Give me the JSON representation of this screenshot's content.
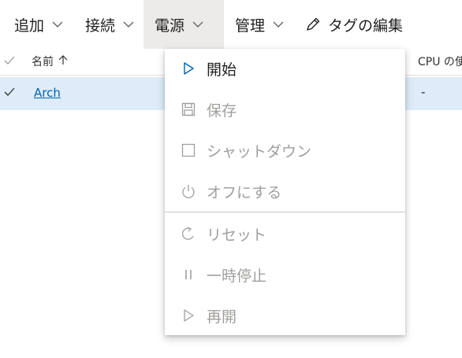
{
  "toolbar": {
    "add": "追加",
    "connect": "接続",
    "power": "電源",
    "manage": "管理",
    "edit_tags": "タグの編集"
  },
  "list": {
    "header": {
      "name": "名前",
      "cpu": "CPU の使"
    },
    "rows": [
      {
        "name": "Arch",
        "cpu": "-"
      }
    ]
  },
  "power_menu": {
    "items": [
      {
        "label": "開始",
        "icon": "play-icon",
        "enabled": true
      },
      {
        "label": "保存",
        "icon": "save-icon",
        "enabled": false
      },
      {
        "label": "シャットダウン",
        "icon": "stop-icon",
        "enabled": false
      },
      {
        "label": "オフにする",
        "icon": "power-icon",
        "enabled": false
      },
      {
        "label": "リセット",
        "icon": "reset-icon",
        "enabled": false
      },
      {
        "label": "一時停止",
        "icon": "pause-icon",
        "enabled": false
      },
      {
        "label": "再開",
        "icon": "resume-icon",
        "enabled": false
      }
    ]
  },
  "colors": {
    "accent": "#0063b1",
    "selected_row": "#deecf9",
    "active_toolbar": "#edebe9",
    "disabled_text": "#a19f9d"
  }
}
